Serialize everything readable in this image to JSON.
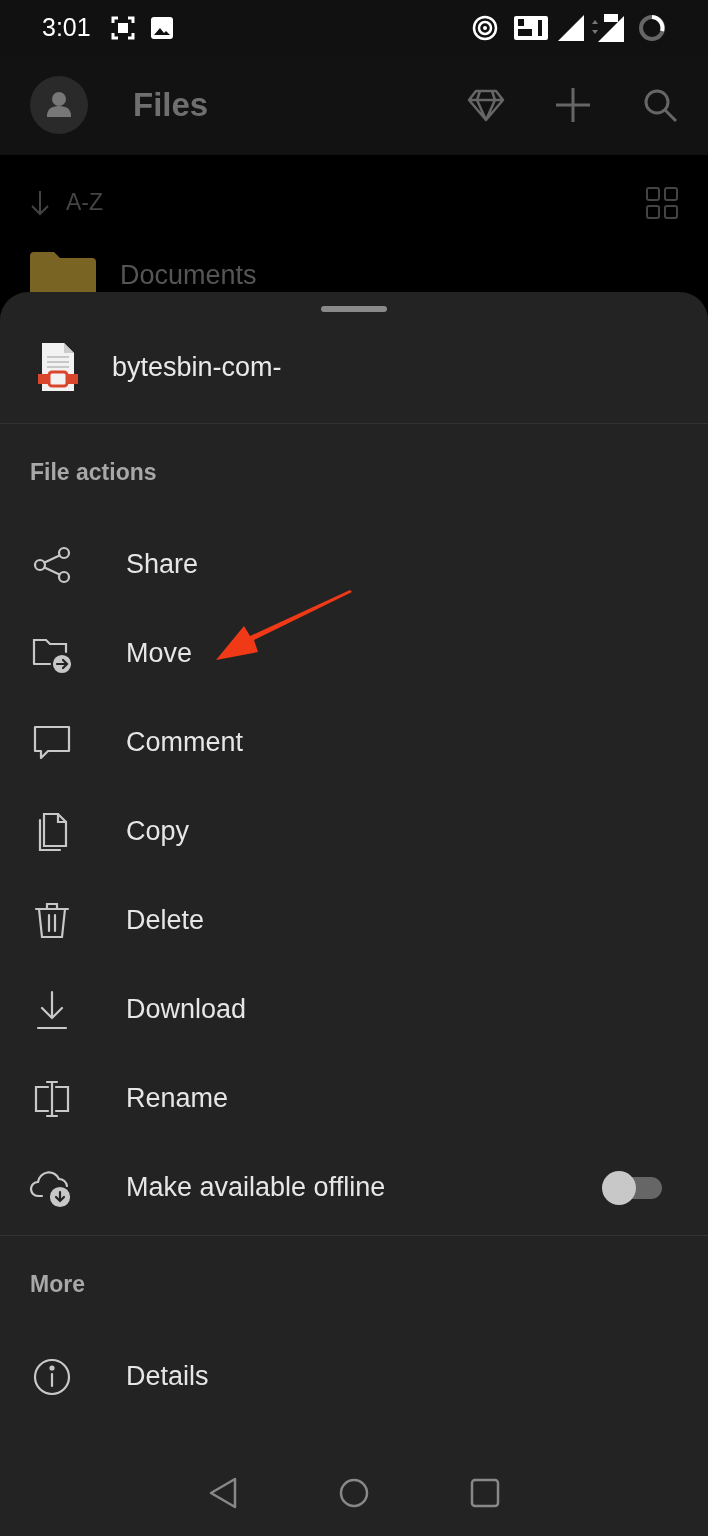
{
  "status_bar": {
    "time": "3:01"
  },
  "app_bar": {
    "title": "Files"
  },
  "sort": {
    "label": "A-Z"
  },
  "folders": [
    {
      "name": "Documents"
    }
  ],
  "sheet": {
    "file_name": "bytesbin-com-",
    "sections": [
      {
        "title": "File actions",
        "items": [
          {
            "kind": "action",
            "label": "Share"
          },
          {
            "kind": "action",
            "label": "Move"
          },
          {
            "kind": "action",
            "label": "Comment"
          },
          {
            "kind": "action",
            "label": "Copy"
          },
          {
            "kind": "action",
            "label": "Delete"
          },
          {
            "kind": "action",
            "label": "Download"
          },
          {
            "kind": "action",
            "label": "Rename"
          },
          {
            "kind": "toggle",
            "label": "Make available offline",
            "on": false
          }
        ]
      },
      {
        "title": "More",
        "items": [
          {
            "kind": "action",
            "label": "Details"
          }
        ]
      }
    ]
  }
}
